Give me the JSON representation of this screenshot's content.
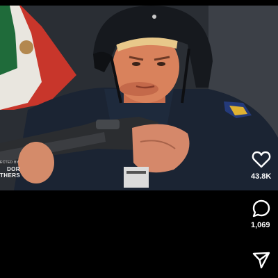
{
  "video": {
    "credit_small": "ECTED BY",
    "credit_line1": "DOR",
    "credit_line2": "THERS"
  },
  "actions": {
    "like_icon": "heart-icon",
    "like_count": "43.8K",
    "comment_icon": "comment-icon",
    "comment_count": "1,069",
    "share_icon": "share-icon"
  }
}
